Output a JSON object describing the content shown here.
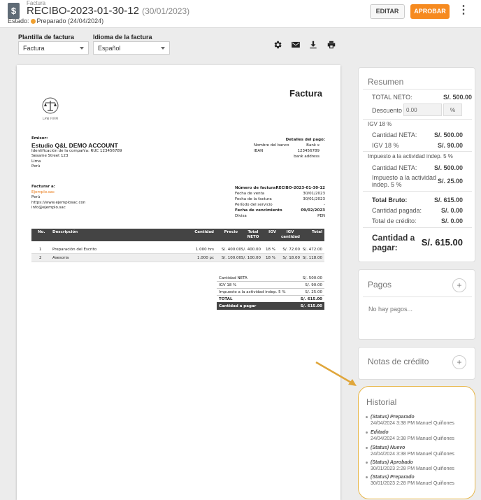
{
  "header": {
    "crumb": "Factura",
    "title": "RECIBO-2023-01-30-12",
    "title_date": "(30/01/2023)",
    "state_label": "Estado:",
    "state_value": "Preparado (24/04/2024)",
    "edit_label": "EDITAR",
    "approve_label": "APROBAR",
    "more_icon": "⋮"
  },
  "controls": {
    "template_label": "Plantilla de factura",
    "template_value": "Factura",
    "language_label": "Idioma de la factura",
    "language_value": "Español",
    "icons": [
      "gear-icon",
      "mail-icon",
      "download-icon",
      "print-icon"
    ]
  },
  "invoice": {
    "heading": "Factura",
    "logo_text": "LAW FIRM",
    "emitter_label": "Emisor:",
    "company": "Estudio Q&L DEMO ACCOUNT",
    "company_id": "Identificación de la compañía: RUC 123456789",
    "address1": "Sesame Street 123",
    "city": "Lima",
    "country": "Perú",
    "payment_label": "Detalles del pago:",
    "bank_name_label": "Nombre del banco",
    "bank_name_value": "Bank x",
    "iban_label": "IBAN",
    "iban_value": "123456789",
    "bank_address": "bank address",
    "bill_to_label": "Facturar a:",
    "client_name": "Ejemplo.sac",
    "client_country": "Perú",
    "client_web": "https://www.ejemplosac.con",
    "client_email": "info@ejemplo.sac",
    "number_label": "Número de factura",
    "number_value": "RECIBO-2023-01-30-12",
    "sale_date_label": "Fecha de venta",
    "sale_date_value": "30/01/2023",
    "invoice_date_label": "Fecha de la factura",
    "invoice_date_value": "30/01/2023",
    "period_label": "Período del servicio",
    "period_value": "-",
    "due_label": "Fecha de vencimiento",
    "due_value": "09/02/2023",
    "currency_label": "Divisa",
    "currency_value": "PEN",
    "table_headers": [
      "No.",
      "Descripción",
      "Cantidad",
      "Precio",
      "Total NETO",
      "IGV",
      "IGV cantidad",
      "Total"
    ],
    "rows": [
      [
        "1",
        "Preparación del Escrito",
        "1.000 hrs",
        "S/. 400.00",
        "S/. 400.00",
        "18 %",
        "S/. 72.00",
        "S/. 472.00"
      ],
      [
        "2",
        "Asesoria",
        "1.000 pc",
        "S/. 100.00",
        "S/. 100.00",
        "18 %",
        "S/. 18.00",
        "S/. 118.00"
      ]
    ],
    "totals": [
      {
        "label": "Cantidad NETA",
        "value": "S/. 500.00"
      },
      {
        "label": "IGV 18 %",
        "value": "S/. 90.00"
      },
      {
        "label": "Impuesto a la actividad indep. 5 %",
        "value": "S/. 25.00"
      },
      {
        "label": "TOTAL",
        "value": "S/. 615.00"
      },
      {
        "label": "Cantidad a pagar",
        "value": "S/. 615.00"
      }
    ]
  },
  "summary": {
    "title": "Resumen",
    "total_net_label": "TOTAL NETO:",
    "total_net_value": "S/. 500.00",
    "discount_label": "Descuento",
    "discount_value": "0.00",
    "discount_unit": "%",
    "igv_section": "IGV 18 %",
    "net_amount_label": "Cantidad NETA:",
    "net_amount_value": "S/. 500.00",
    "igv_label": "IGV 18 %",
    "igv_value": "S/. 90.00",
    "tax_section": "Impuesto a la actividad indep. 5 %",
    "net_amount2_label": "Cantidad NETA:",
    "net_amount2_value": "S/. 500.00",
    "tax_label_1": "Impuesto a la actividad",
    "tax_label_2": "indep. 5 %",
    "tax_value": "S/. 25.00",
    "gross_label": "Total Bruto:",
    "gross_value": "S/. 615.00",
    "paid_label": "Cantidad pagada:",
    "paid_value": "S/. 0.00",
    "credit_label": "Total de crédito:",
    "credit_value": "S/. 0.00",
    "to_pay_label_1": "Cantidad a",
    "to_pay_label_2": "pagar:",
    "to_pay_value": "S/. 615.00"
  },
  "payments": {
    "title": "Pagos",
    "empty": "No hay pagos...",
    "add": "+"
  },
  "credit_notes": {
    "title": "Notas de crédito",
    "add": "+"
  },
  "history": {
    "title": "Historial",
    "items": [
      {
        "action": "(Status) Preparado",
        "meta": "24/04/2024 3:38 PM Manuel Quiñones"
      },
      {
        "action": "Editado",
        "meta": "24/04/2024 3:38 PM Manuel Quiñones"
      },
      {
        "action": "(Status) Nuevo",
        "meta": "24/04/2024 3:38 PM Manuel Quiñones"
      },
      {
        "action": "(Status) Aprobado",
        "meta": "30/01/2023 2:28 PM Manuel Quiñones"
      },
      {
        "action": "(Status) Preparado",
        "meta": "30/01/2023 2:28 PM Manuel Quiñones"
      }
    ]
  },
  "colors": {
    "accent": "#f68a1f",
    "status_dot": "#f0a030",
    "highlight": "#e8b74a",
    "client_name": "#e97a17"
  }
}
